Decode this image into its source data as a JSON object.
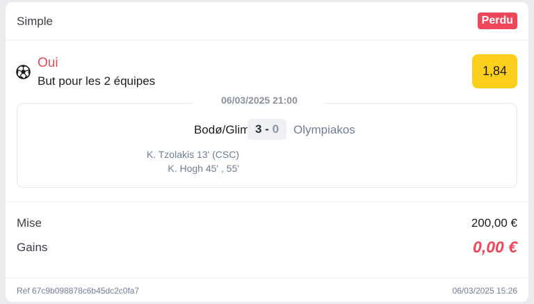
{
  "header": {
    "bet_type": "Simple",
    "status": "Perdu"
  },
  "selection": {
    "icon": "soccer-ball-icon",
    "pick": "Oui",
    "market": "But pour les 2 équipes",
    "odds": "1,84"
  },
  "match": {
    "datetime": "06/03/2025 21:00",
    "home_team": "Bodø/Glimt",
    "away_team": "Olympiakos",
    "score_home": "3",
    "score_separator": "-",
    "score_away": "0",
    "scorers": [
      "K. Tzolakis 13'  (CSC)",
      "K. Hogh 45' , 55'"
    ]
  },
  "stakes": {
    "stake_label": "Mise",
    "stake_value": "200,00 €",
    "gains_label": "Gains",
    "gains_value": "0,00 €"
  },
  "footer": {
    "ref": "Réf 67c9b098878c6b45dc2c0fa7",
    "placed_at": "06/03/2025 15:26"
  },
  "colors": {
    "lost_red": "#f0465a",
    "odds_yellow": "#fccf1c",
    "muted_blue": "#6f7d95"
  }
}
